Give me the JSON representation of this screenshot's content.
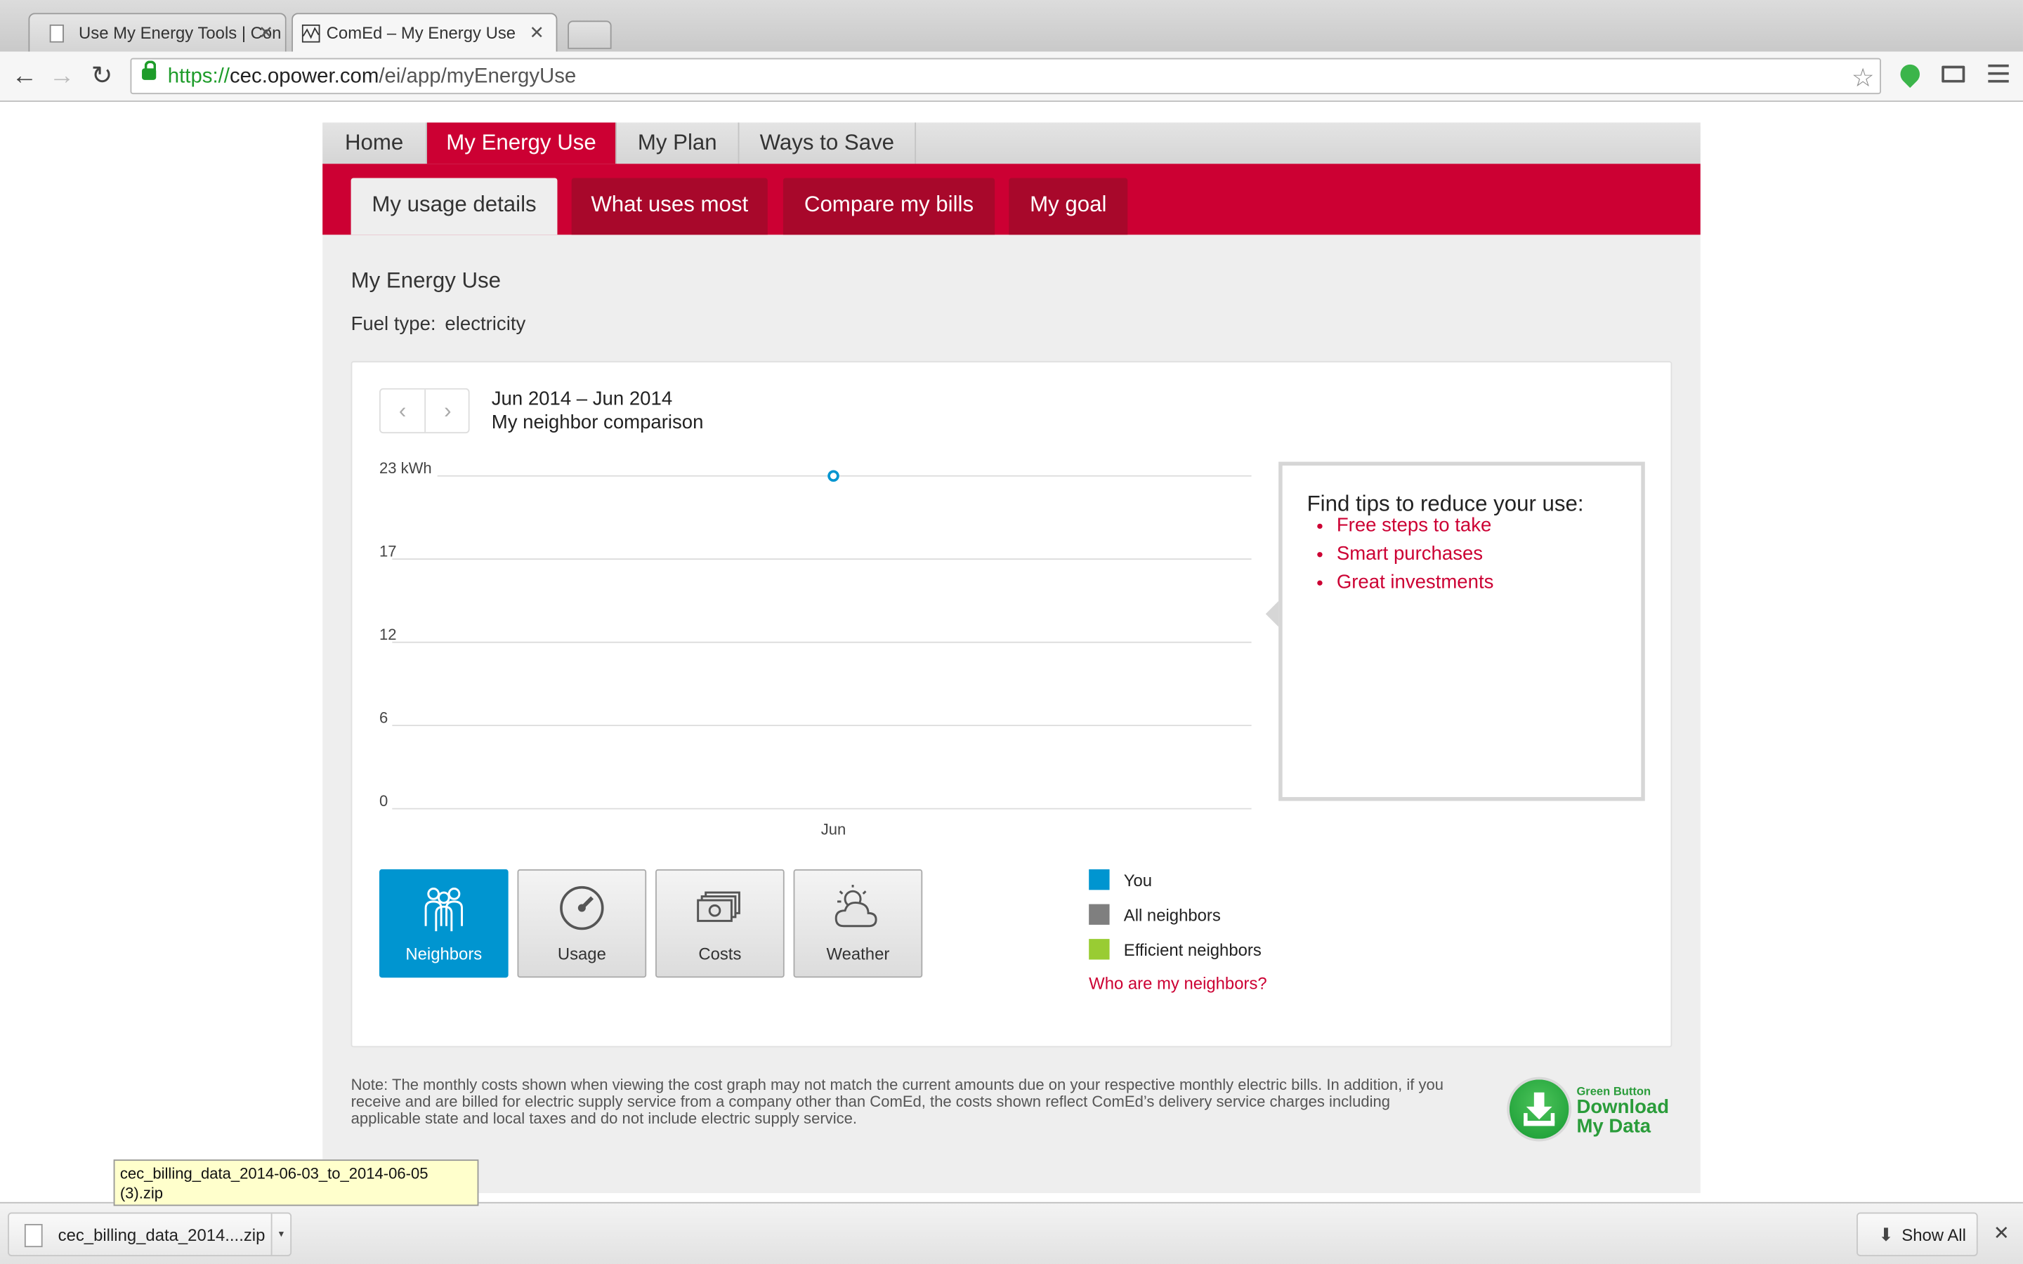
{
  "browser": {
    "tabs": [
      {
        "title": "Use My Energy Tools | Con",
        "active": false
      },
      {
        "title": "ComEd – My Energy Use",
        "active": true
      }
    ],
    "url": {
      "scheme": "https://",
      "host": "cec.opower.com",
      "path": "/ei/app/myEnergyUse"
    }
  },
  "nav": {
    "main_tabs": [
      {
        "label": "Home"
      },
      {
        "label": "My Energy Use",
        "active": true
      },
      {
        "label": "My Plan"
      },
      {
        "label": "Ways to Save"
      }
    ],
    "sub_tabs": [
      {
        "label": "My usage details",
        "active": true
      },
      {
        "label": "What uses most"
      },
      {
        "label": "Compare my bills"
      },
      {
        "label": "My goal"
      }
    ]
  },
  "page": {
    "heading": "My Energy Use",
    "fuel_label": "Fuel type:",
    "fuel_value": "electricity"
  },
  "card": {
    "date_range": "Jun 2014 – Jun 2014",
    "subtitle": "My neighbor comparison"
  },
  "chart_data": {
    "type": "scatter",
    "categories": [
      "Jun"
    ],
    "series": [
      {
        "name": "You",
        "values": [
          23
        ]
      }
    ],
    "y_ticks": [
      "23 kWh",
      "17",
      "12",
      "6",
      "0"
    ],
    "ylim": [
      0,
      23
    ],
    "grid": true,
    "legend_position": "bottom-right",
    "colors": {
      "You": "#0095d0",
      "All neighbors": "#7f7f7f",
      "Efficient neighbors": "#99cc33"
    }
  },
  "tips": {
    "title": "Find tips to reduce your use:",
    "links": [
      "Free steps to take",
      "Smart purchases",
      "Great investments"
    ]
  },
  "views": [
    {
      "label": "Neighbors",
      "icon": "neighbors-icon",
      "active": true
    },
    {
      "label": "Usage",
      "icon": "gauge-icon"
    },
    {
      "label": "Costs",
      "icon": "money-icon"
    },
    {
      "label": "Weather",
      "icon": "weather-icon"
    }
  ],
  "legend": {
    "items": [
      {
        "label": "You",
        "color": "#0095d0"
      },
      {
        "label": "All neighbors",
        "color": "#7f7f7f"
      },
      {
        "label": "Efficient neighbors",
        "color": "#99cc33"
      }
    ],
    "link": "Who are my neighbors?"
  },
  "note": "Note: The monthly costs shown when viewing the cost graph may not match the current amounts due on your respective monthly electric bills. In addition, if you receive and are billed for electric supply service from a company other than ComEd, the costs shown reflect ComEd’s delivery service charges including applicable state and local taxes and do not include electric supply service.",
  "green_button": {
    "line1": "Green Button",
    "line2": "Download",
    "line3": "My Data"
  },
  "downloads": {
    "item": "cec_billing_data_2014....zip",
    "tooltip": "cec_billing_data_2014-06-03_to_2014-06-05 (3).zip",
    "show_all": "Show All"
  },
  "accent": "#cc0033"
}
